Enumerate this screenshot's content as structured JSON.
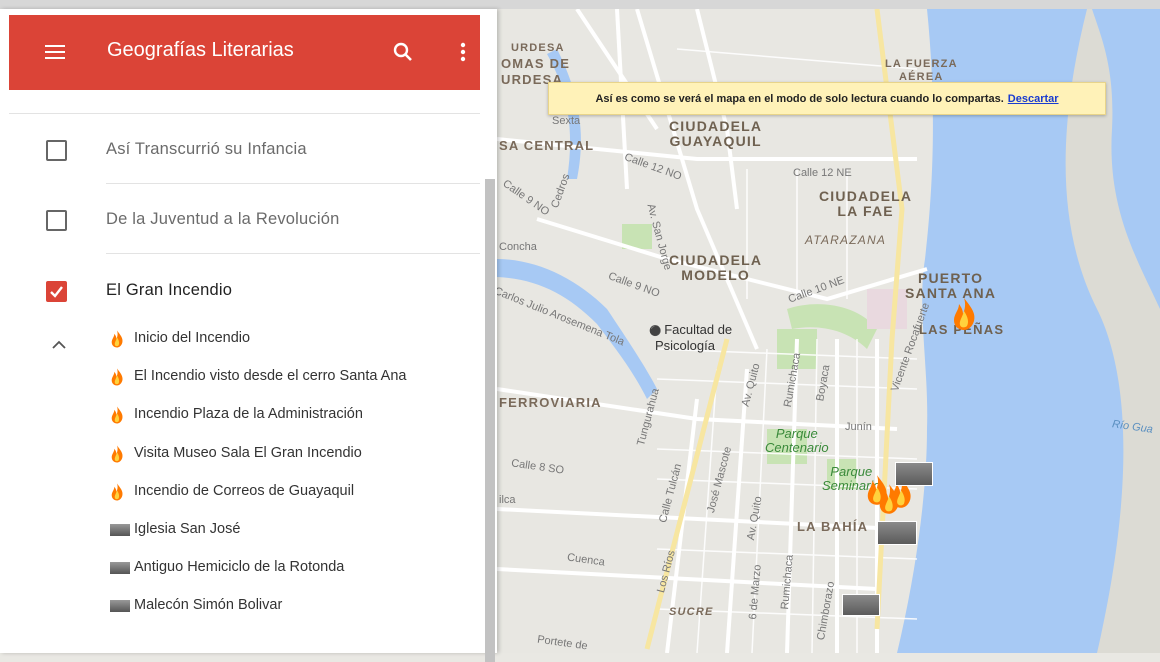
{
  "app": {
    "title": "Geografías Literarias"
  },
  "notice": {
    "text": "Así es como se verá el mapa en el modo de solo lectura cuando lo compartas.",
    "dismiss": "Descartar"
  },
  "layers": [
    {
      "name": "Así Transcurrió su Infancia",
      "checked": false
    },
    {
      "name": "De la Juventud a la Revolución",
      "checked": false
    },
    {
      "name": "El Gran Incendio",
      "checked": true
    }
  ],
  "items": [
    {
      "label": "Inicio del Incendio",
      "icon": "fire-icon"
    },
    {
      "label": "El Incendio visto desde el cerro Santa Ana",
      "icon": "fire-icon"
    },
    {
      "label": "Incendio Plaza de la Administración",
      "icon": "fire-icon"
    },
    {
      "label": "Visita Museo Sala El Gran Incendio",
      "icon": "fire-icon"
    },
    {
      "label": "Incendio de Correos de Guayaquil",
      "icon": "fire-icon"
    },
    {
      "label": "Iglesia San José",
      "icon": "photo-icon"
    },
    {
      "label": "Antiguo Hemiciclo de la Rotonda",
      "icon": "photo-icon"
    },
    {
      "label": "Malecón Simón Bolivar",
      "icon": "photo-icon"
    }
  ],
  "map": {
    "labels": {
      "urdesa": "URDESA",
      "lomas": "OMAS DE",
      "urdesa2": "URDESA",
      "fuerza1": "LA FUERZA",
      "fuerza2": "AÉREA",
      "sexta": "Sexta",
      "cg1": "CIUDADELA",
      "cg2": "GUAYAQUIL",
      "central": "SA CENTRAL",
      "calle12no": "Calle 12 NO",
      "calle12ne": "Calle 12 NE",
      "cedros": "Cedros",
      "calle9no_a": "Calle 9 NO",
      "fae1": "CIUDADELA",
      "fae2": "LA FAE",
      "atarazana": "ATARAZANA",
      "concha": "Concha",
      "sanjorge": "Av. San Jorge",
      "modelo1": "CIUDADELA",
      "modelo2": "MODELO",
      "calle9no": "Calle 9 NO",
      "calle10ne": "Calle 10 NE",
      "santaana1": "PUERTO",
      "santaana2": "SANTA ANA",
      "penas": "LAS PEÑAS",
      "carlos": "Carlos Julio Arosemena Tola",
      "facultad1": "Facultad de",
      "facultad2": "Psicología",
      "ferroviaria": "FERROVIARIA",
      "quito": "Av. Quito",
      "rumichaca": "Rumichaca",
      "boyaca": "Boyaca",
      "rocafuerte": "Vicente Rocafuerte",
      "junin": "Junín",
      "rioguayas": "Río Gua",
      "parque1": "Parque",
      "parque2": "Centenario",
      "tungurahua": "Tungurahua",
      "calle8so": "Calle 8 SO",
      "tulcan": "Calle Tulcán",
      "mascote": "José Mascote",
      "quito2": "Av. Quito",
      "seminario1": "Parque",
      "seminario2": "Seminario",
      "ilca": "ilca",
      "bahia": "LA BAHÍA",
      "cuenca": "Cuenca",
      "losrios": "Los Ríos",
      "seismarzo": "6 de Marzo",
      "rumichaca2": "Rumichaca",
      "chimborazo": "Chimborazo",
      "sucre": "SUCRE",
      "portete": "Portete de"
    }
  }
}
